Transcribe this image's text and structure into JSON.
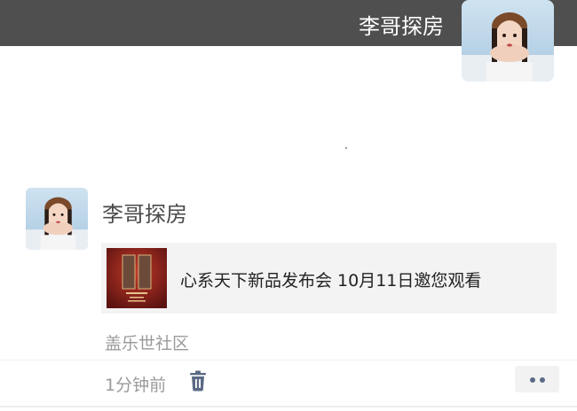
{
  "header": {
    "title": "李哥探房"
  },
  "post": {
    "author": "李哥探房",
    "share": {
      "title": "心系天下新品发布会 10月11日邀您观看"
    },
    "location": "盖乐世社区",
    "time": "1分钟前"
  },
  "icons": {
    "delete": "trash-icon",
    "more": "more-dots-icon"
  },
  "colors": {
    "topbar": "#4f4f4f",
    "card_bg": "#f3f3f3",
    "icon_blue": "#5b6a85",
    "muted_text": "#9a9a9a"
  }
}
